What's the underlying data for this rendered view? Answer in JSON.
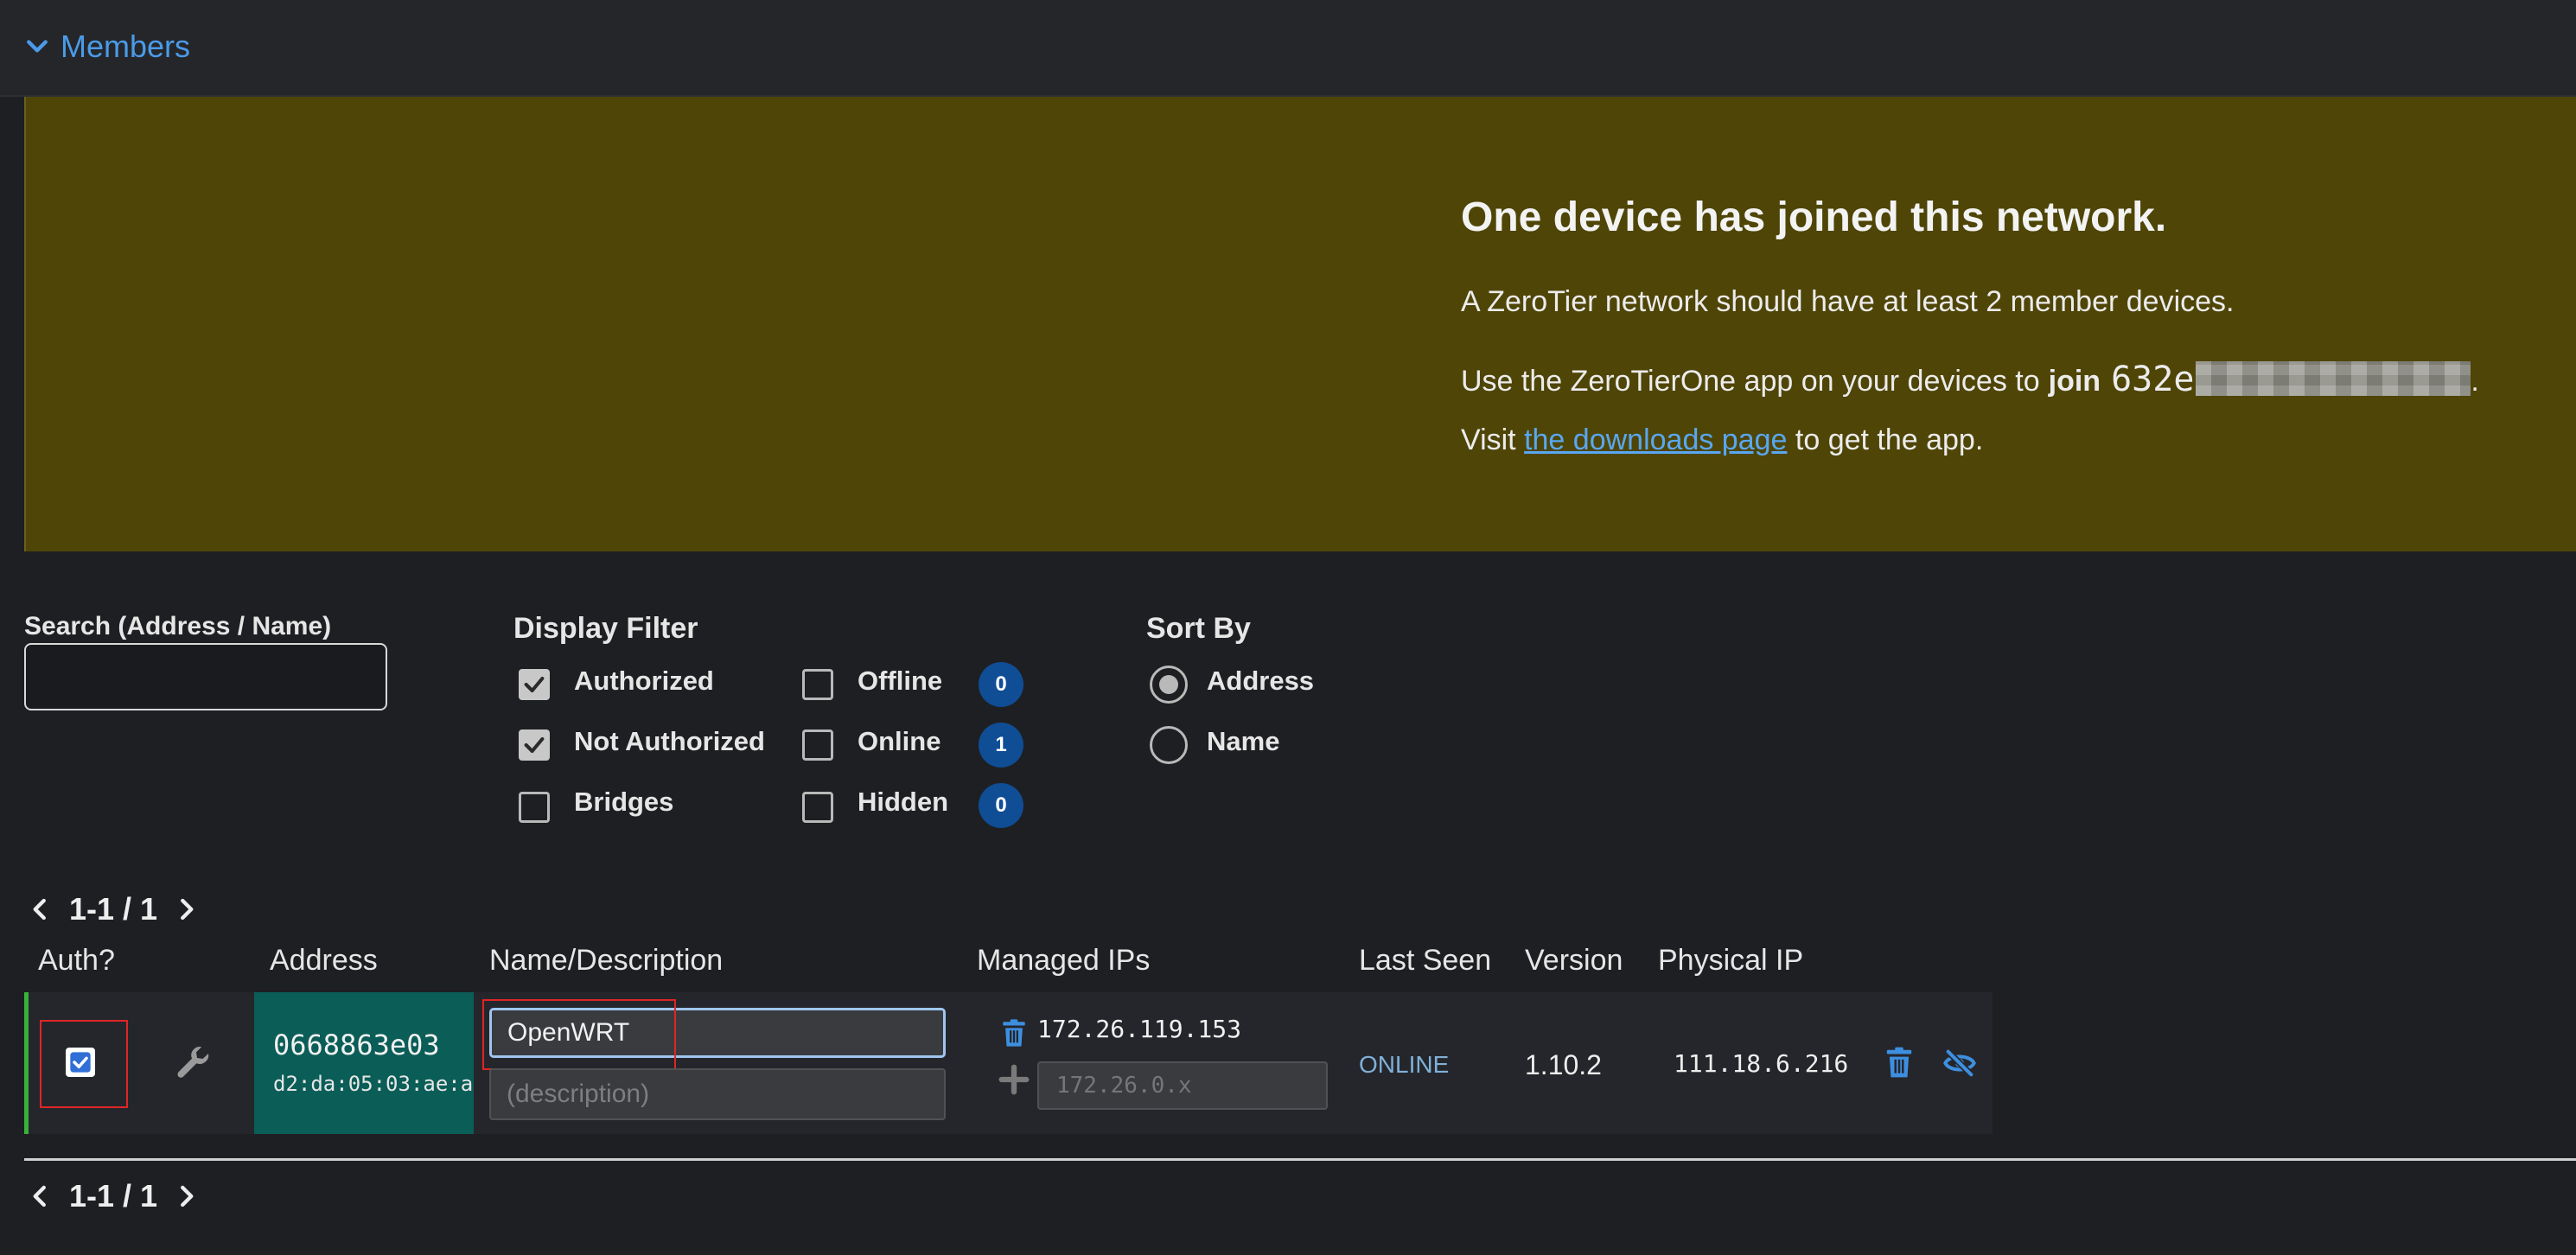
{
  "header": {
    "members_label": "Members"
  },
  "banner": {
    "title": "One device has joined this network.",
    "line1": "A ZeroTier network should have at least 2 member devices.",
    "line2_prefix": "Use the ZeroTierOne app on your devices to",
    "line2_join": "join",
    "network_id_visible": "632e",
    "line2_suffix": ".",
    "line3_prefix": "Visit",
    "line3_link": "the downloads page",
    "line3_suffix": "to get the app."
  },
  "search": {
    "label": "Search (Address / Name)",
    "value": "",
    "placeholder": ""
  },
  "display_filter": {
    "title": "Display Filter",
    "options": [
      {
        "label": "Authorized",
        "checked": true
      },
      {
        "label": "Not Authorized",
        "checked": true
      },
      {
        "label": "Bridges",
        "checked": false
      },
      {
        "label": "Offline",
        "checked": false,
        "count": "0"
      },
      {
        "label": "Online",
        "checked": false,
        "count": "1"
      },
      {
        "label": "Hidden",
        "checked": false,
        "count": "0"
      }
    ]
  },
  "sort_by": {
    "title": "Sort By",
    "options": [
      {
        "label": "Address",
        "selected": true
      },
      {
        "label": "Name",
        "selected": false
      }
    ]
  },
  "pagination": {
    "top_text": "1-1 / 1",
    "bottom_text": "1-1 / 1"
  },
  "table": {
    "headers": [
      "Auth?",
      "Address",
      "Name/Description",
      "Managed IPs",
      "Last Seen",
      "Version",
      "Physical IP"
    ],
    "rows": [
      {
        "authorized": true,
        "address": "0668863e03",
        "mac": "d2:da:05:03:ae:a",
        "name": "OpenWRT",
        "description": "",
        "description_placeholder": "(description)",
        "managed_ip": "172.26.119.153",
        "ip_placeholder": "172.26.0.x",
        "last_seen": "ONLINE",
        "version": "1.10.2",
        "physical_ip": "111.18.6.216"
      }
    ]
  },
  "colors": {
    "accent": "#4a9be8",
    "banner_bg": "#4f4507",
    "address_bg": "#0b5d57",
    "badge_bg": "#0f4d95",
    "online_border": "#38b23a",
    "highlight": "#e02525"
  },
  "icons": [
    "chevron-down-icon",
    "chevron-left-icon",
    "chevron-right-icon",
    "wrench-icon",
    "trash-icon",
    "plus-icon",
    "eye-slash-icon",
    "check-icon"
  ]
}
